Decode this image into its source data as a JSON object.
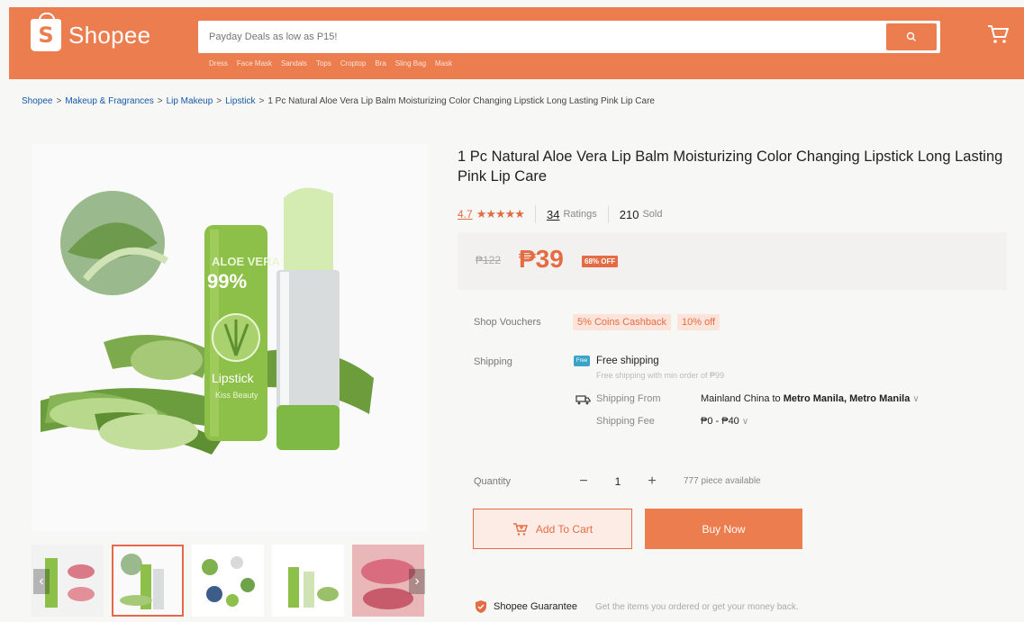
{
  "header": {
    "logo_letter": "S",
    "logo_text": "Shopee",
    "search_placeholder": "Payday Deals as low as P15!",
    "hints": [
      "Dress",
      "Face Mask",
      "Sandals",
      "Tops",
      "Croptop",
      "Bra",
      "Sling Bag",
      "Mask"
    ]
  },
  "breadcrumb": {
    "items": [
      "Shopee",
      "Makeup & Fragrances",
      "Lip Makeup",
      "Lipstick"
    ],
    "current": "1 Pc Natural Aloe Vera Lip Balm Moisturizing Color Changing Lipstick Long Lasting Pink Lip Care"
  },
  "product": {
    "title": "1 Pc Natural Aloe Vera Lip Balm Moisturizing Color Changing Lipstick Long Lasting Pink Lip Care",
    "rating": "4.7",
    "stars": "★★★★★",
    "ratings_count": "34",
    "ratings_label": "Ratings",
    "sold_count": "210",
    "sold_label": "Sold",
    "old_price": "₱122",
    "price": "₱39",
    "discount": "68% OFF",
    "image_text": {
      "brand_top": "ALOE VERA",
      "percent": "99%",
      "name": "Lipstick",
      "maker": "Kiss Beauty"
    }
  },
  "vouchers": {
    "label": "Shop Vouchers",
    "items": [
      "5% Coins Cashback",
      "10% off"
    ]
  },
  "shipping": {
    "label": "Shipping",
    "free_badge": "Free",
    "free_title": "Free shipping",
    "free_sub": "Free shipping with min order of ₱99",
    "from_label": "Shipping From",
    "from_origin": "Mainland China to ",
    "from_dest": "Metro Manila, Metro Manila",
    "fee_label": "Shipping Fee",
    "fee_value": "₱0 - ₱40"
  },
  "quantity": {
    "label": "Quantity",
    "value": "1",
    "minus": "−",
    "plus": "+",
    "available": "777 piece available"
  },
  "actions": {
    "add_to_cart": "Add To Cart",
    "buy_now": "Buy Now"
  },
  "guarantee": {
    "title": "Shopee Guarantee",
    "text": "Get the items you ordered or get your money back."
  },
  "colors": {
    "brand": "#ec7d4f",
    "price": "#e46c44",
    "link": "#1559a9"
  }
}
